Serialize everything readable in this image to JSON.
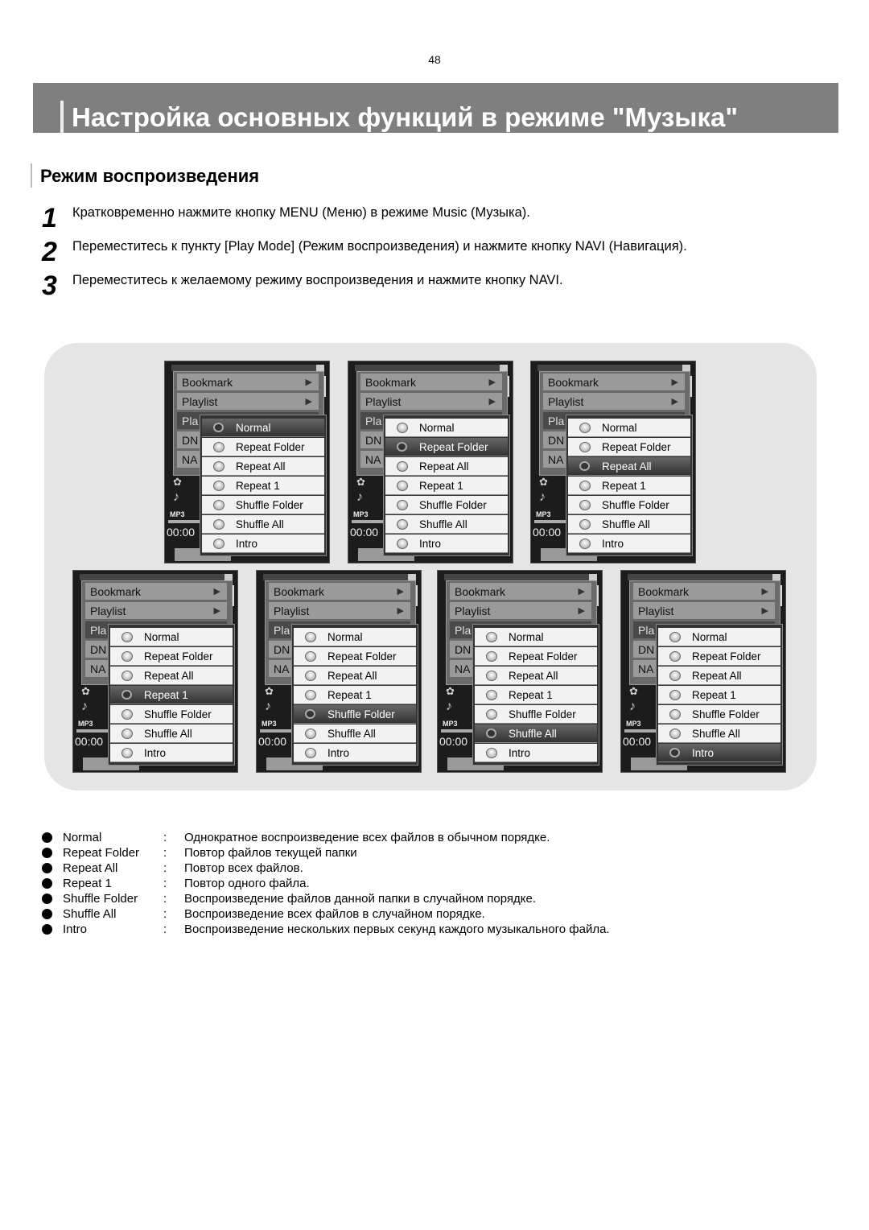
{
  "page_number": "48",
  "title": "Настройка основных функций в режиме \"Музыка\"",
  "section": "Режим воспроизведения",
  "steps": [
    {
      "n": "1",
      "text": "Кратковременно нажмите кнопку MENU (Меню) в режиме Music (Музыка)."
    },
    {
      "n": "2",
      "text": "Переместитесь к пункту [Play Mode] (Режим воспроизведения) и нажмите кнопку NAVI (Навигация)."
    },
    {
      "n": "3",
      "text": "Переместитесь к желаемому режиму воспроизведения и нажмите кнопку NAVI."
    }
  ],
  "device": {
    "menu": [
      "Bookmark",
      "Playlist",
      "Pla",
      "DN",
      "NA"
    ],
    "submenu": [
      "Normal",
      "Repeat Folder",
      "Repeat All",
      "Repeat 1",
      "Shuffle Folder",
      "Shuffle All",
      "Intro"
    ],
    "mp3": "MP3",
    "time": "00:00",
    "selected_per_screen": [
      0,
      1,
      2,
      3,
      4,
      5,
      6
    ]
  },
  "legend": [
    {
      "label": "Normal",
      "sep": ":",
      "desc": "Однократное воспроизведение всех файлов в обычном порядке."
    },
    {
      "label": "Repeat Folder",
      "sep": ":",
      "desc": "Повтор файлов текущей папки"
    },
    {
      "label": "Repeat All",
      "sep": ":",
      "desc": "Повтор всех файлов."
    },
    {
      "label": "Repeat 1",
      "sep": ":",
      "desc": "Повтор одного файла."
    },
    {
      "label": "Shuffle Folder",
      "sep": ":",
      "desc": "Воспроизведение файлов данной папки в случайном порядке."
    },
    {
      "label": "Shuffle All",
      "sep": ":",
      "desc": "Воспроизведение всех файлов в случайном порядке."
    },
    {
      "label": "Intro",
      "sep": ":",
      "desc": "Воспроизведение нескольких первых секунд каждого музыкального файла."
    }
  ]
}
